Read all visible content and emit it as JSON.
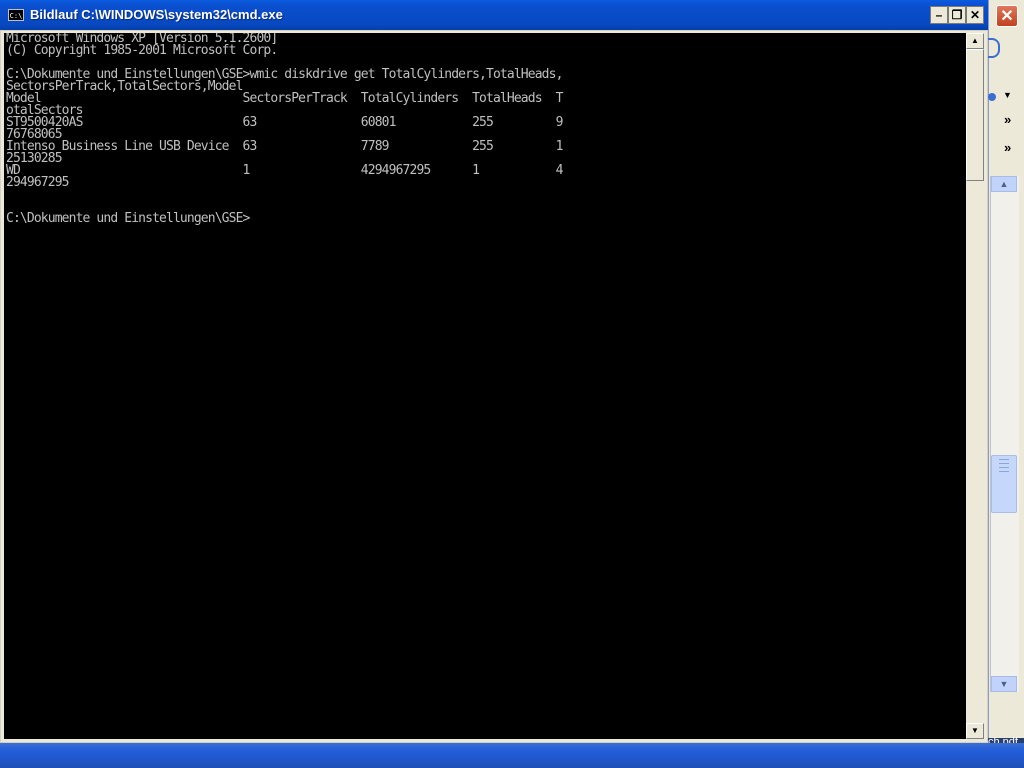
{
  "window": {
    "title": "Bildlauf C:\\WINDOWS\\system32\\cmd.exe",
    "icon_text": "C:\\",
    "minimize_glyph": "–",
    "maximize_glyph": "❐",
    "close_glyph": "✕"
  },
  "console": {
    "lines": [
      "Microsoft Windows XP [Version 5.1.2600]",
      "(C) Copyright 1985-2001 Microsoft Corp.",
      "",
      "C:\\Dokumente und Einstellungen\\GSE>wmic diskdrive get TotalCylinders,TotalHeads,",
      "SectorsPerTrack,TotalSectors,Model",
      "Model                             SectorsPerTrack  TotalCylinders  TotalHeads  T",
      "otalSectors",
      "ST9500420AS                       63               60801           255         9",
      "76768065",
      "Intenso Business Line USB Device  63               7789            255         1",
      "25130285",
      "WD                                1                4294967295      1           4",
      "294967295",
      "",
      "",
      "C:\\Dokumente und Einstellungen\\GSE>"
    ]
  },
  "scrollbar": {
    "up_glyph": "▲",
    "down_glyph": "▼"
  },
  "background_window": {
    "close_glyph": "✕",
    "chevron_glyph": "»",
    "dropdown_glyph": "▼",
    "scroll_up_glyph": "▲",
    "scroll_down_glyph": "▼",
    "label": "ch.pdf"
  }
}
